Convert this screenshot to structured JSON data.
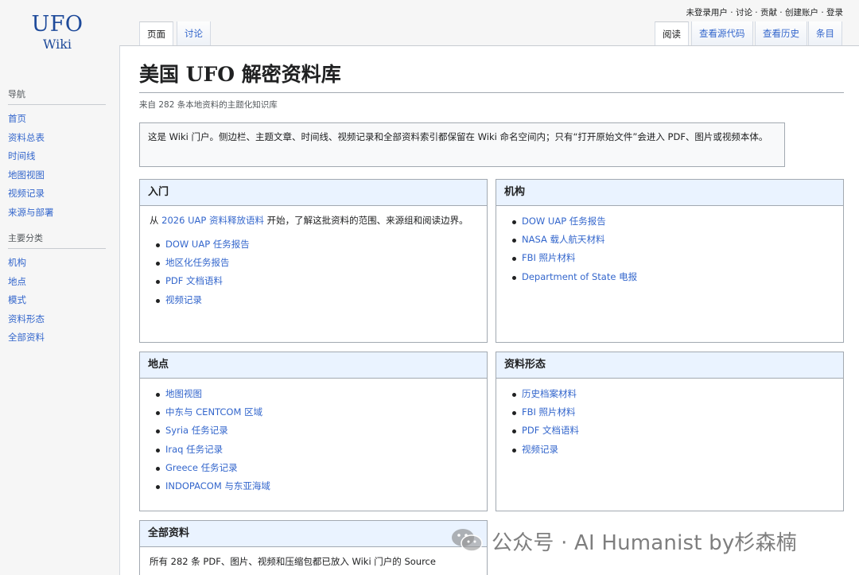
{
  "logo": {
    "line1": "UFO",
    "line2": "Wiki"
  },
  "sidebar": {
    "nav_heading": "导航",
    "nav_items": [
      "首页",
      "资料总表",
      "时间线",
      "地图视图",
      "视频记录",
      "来源与部署"
    ],
    "cat_heading": "主要分类",
    "cat_items": [
      "机构",
      "地点",
      "模式",
      "资料形态",
      "全部资料"
    ]
  },
  "personal_bar": "未登录用户 · 讨论 · 贡献 · 创建账户 · 登录",
  "tabs": {
    "left": [
      {
        "label": "页面",
        "selected": true
      },
      {
        "label": "讨论",
        "selected": false
      }
    ],
    "right": [
      {
        "label": "阅读",
        "selected": true
      },
      {
        "label": "查看源代码",
        "selected": false
      },
      {
        "label": "查看历史",
        "selected": false
      },
      {
        "label": "条目",
        "selected": false
      }
    ]
  },
  "page": {
    "title": "美国 UFO 解密资料库",
    "subtitle": "来自 282 条本地资料的主题化知识库",
    "intro": "这是 Wiki 门户。侧边栏、主题文章、时间线、视频记录和全部资料索引都保留在 Wiki 命名空间内；只有“打开原始文件”会进入 PDF、图片或视频本体。"
  },
  "boxes": {
    "intro_box": {
      "title": "入门",
      "para_prefix": "从 ",
      "para_link": "2026 UAP 资料释放语料",
      "para_suffix": " 开始，了解这批资料的范围、来源组和阅读边界。",
      "items": [
        "DOW UAP 任务报告",
        "地区化任务报告",
        "PDF 文档语料",
        "视频记录"
      ]
    },
    "agencies": {
      "title": "机构",
      "items": [
        "DOW UAP 任务报告",
        "NASA 载人航天材料",
        "FBI 照片材料",
        "Department of State 电报"
      ]
    },
    "places": {
      "title": "地点",
      "items": [
        "地图视图",
        "中东与 CENTCOM 区域",
        "Syria 任务记录",
        "Iraq 任务记录",
        "Greece 任务记录",
        "INDOPACOM 与东亚海域"
      ]
    },
    "forms": {
      "title": "资料形态",
      "items": [
        "历史档案材料",
        "FBI 照片材料",
        "PDF 文档语料",
        "视频记录"
      ]
    },
    "all": {
      "title": "全部资料",
      "para": "所有 282 条 PDF、图片、视频和压缩包都已放入 Wiki 门户的 Source"
    }
  },
  "watermark": {
    "text": "公众号 · AI Humanist by杉森楠",
    "icon": "wechat-icon"
  },
  "colors": {
    "link": "#3366cc",
    "box_header": "#eaf3ff",
    "border": "#a2a9b1"
  }
}
